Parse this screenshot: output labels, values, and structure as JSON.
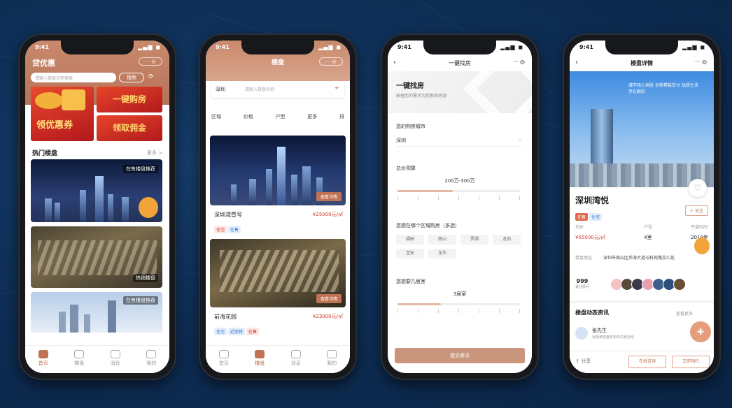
{
  "colors": {
    "accent": "#c07353",
    "price": "#d0392b",
    "background": "#0e2f57"
  },
  "phone1": {
    "app_title": "贷优惠",
    "search_placeholder": "请输入楼盘名称搜索",
    "search_button": "搜索",
    "banner_left": "领优惠券",
    "banner_right_top": "一键购房",
    "banner_right_bottom": "领取佣金",
    "section_title": "热门楼盘",
    "section_more": "更多 >",
    "card1_tag": "在售楼盘推荐",
    "card2_tag": "热销楼盘",
    "card3_tag": "在售楼盘推荐",
    "tabs": [
      "首页",
      "楼盘",
      "消息",
      "我的"
    ]
  },
  "phone2": {
    "title": "楼盘",
    "city_select": "深圳",
    "search_placeholder": "请输入楼盘名称",
    "filters": [
      "区域",
      "价格",
      "户型",
      "更多",
      "排"
    ],
    "listings": [
      {
        "name": "深圳湾壹号",
        "price": "¥25000元/㎡",
        "tags": [
          "住宅",
          "在售"
        ],
        "button": "查看详情"
      },
      {
        "name": "前海花园",
        "price": "¥23000元/㎡",
        "tags": [
          "住宅",
          "近地铁",
          "在售"
        ],
        "button": "查看详情"
      }
    ],
    "tabs": [
      "首页",
      "楼盘",
      "消息",
      "我的"
    ]
  },
  "phone3": {
    "title": "一键找房",
    "heading": "一键找房",
    "subheading": "根据您的需求为您推荐房源",
    "q1_label": "您的购房城市",
    "q1_value": "深圳",
    "q2_label": "总价预算",
    "q2_value": "200万-300万",
    "q2_fill": 0.45,
    "q3_label": "您想在哪个区域购房（多选）",
    "districts": [
      "福田",
      "南山",
      "罗湖",
      "龙岗",
      "宝安",
      "龙华"
    ],
    "q4_label": "您想要几居室",
    "q4_value": "3居室",
    "q4_fill": 0.35,
    "submit": "提交需求"
  },
  "phone4": {
    "title": "楼盘详情",
    "hero_caption": "城市核心地段 全新精装交付 品质生活 尽在眼前",
    "name": "深圳湾悦",
    "tags": [
      "在售",
      "住宅"
    ],
    "follow": "+ 关注",
    "metrics": [
      {
        "label": "均价",
        "value": "¥55000元/㎡"
      },
      {
        "label": "户型",
        "value": "4室"
      },
      {
        "label": "开盘时间",
        "value": "2019年"
      }
    ],
    "address_label": "楼盘地址",
    "address": "深圳市南山区后海大道与科苑路交汇处",
    "consultant_count": "999",
    "consultant_label": "置业顾问",
    "section": "楼盘动态资讯",
    "section_more": "查看更多",
    "post_author": "张先生",
    "post_sub": "近期该楼盘有新的优惠活动",
    "share": "分享",
    "btn1": "在线咨询",
    "btn2": "立即预约"
  }
}
